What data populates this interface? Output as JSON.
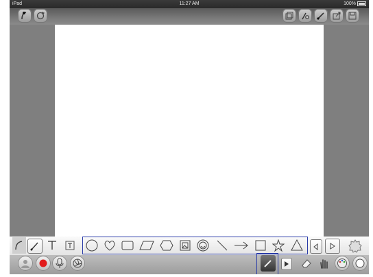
{
  "status": {
    "device": "iPad",
    "time": "11:27 AM",
    "battery": "100%"
  },
  "topbar": {
    "left_icons": [
      "brush-menu-icon",
      "reset-icon"
    ],
    "right_icons": [
      "layers-icon",
      "add-brush-icon",
      "paint-brush-icon",
      "share-icon",
      "save-icon"
    ]
  },
  "toolbar1": {
    "tools": [
      "brush-icon",
      "text-icon",
      "textbox-icon"
    ],
    "shapes": [
      "circle-icon",
      "heart-icon",
      "rectangle-icon",
      "parallelogram-icon",
      "hexagon-icon",
      "image-icon",
      "sticker-icon",
      "line-icon",
      "arrow-icon",
      "square-icon",
      "star-icon",
      "triangle-icon"
    ],
    "nav": [
      "prev-icon",
      "next-icon",
      "gear-icon"
    ]
  },
  "toolbar2": {
    "left": [
      "profile-icon",
      "record-icon",
      "microphone-icon",
      "aperture-icon"
    ],
    "right": [
      "pen-icon",
      "play-icon",
      "eraser-icon",
      "hand-icon",
      "palette-icon",
      "circle-tool-icon"
    ]
  },
  "colors": {
    "selection": "#2a3ca8",
    "record": "#e21b1b",
    "frame": "#8a8a8a"
  }
}
